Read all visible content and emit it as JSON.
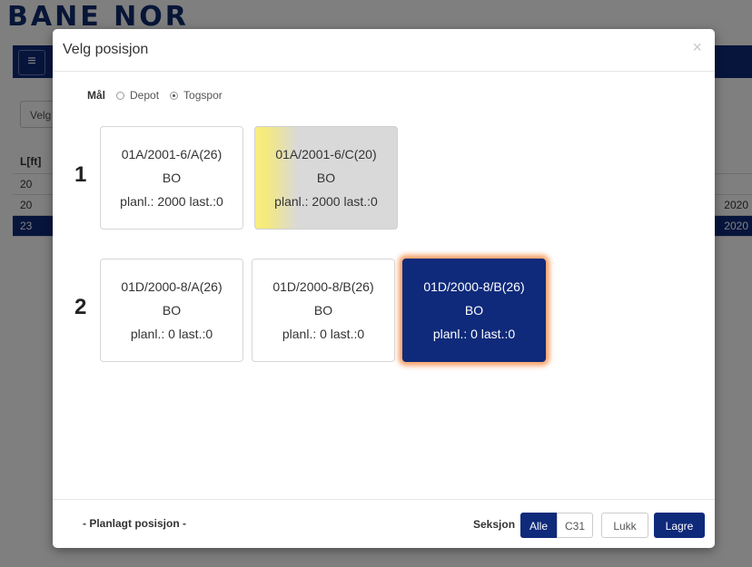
{
  "background": {
    "logo": "BANE NOR",
    "menu_icon": "hamburger-icon",
    "select_placeholder": "Velg",
    "table": {
      "header": "L[ft]",
      "rows": [
        {
          "value": "20",
          "right": ""
        },
        {
          "value": "20",
          "right": "2020"
        },
        {
          "value": "23",
          "right": "2020"
        }
      ]
    }
  },
  "modal": {
    "title": "Velg posisjon",
    "close_icon": "close-icon",
    "mal": {
      "label": "Mål",
      "options": [
        "Depot",
        "Togspor"
      ],
      "selected": "Togspor"
    },
    "groups": [
      {
        "number": "1",
        "cards": [
          {
            "code": "01A/2001-6/A(26)",
            "type": "BO",
            "status": "planl.: 2000 last.:0",
            "state": "normal"
          },
          {
            "code": "01A/2001-6/C(20)",
            "type": "BO",
            "status": "planl.: 2000 last.:0",
            "state": "occupied"
          }
        ]
      },
      {
        "number": "2",
        "cards": [
          {
            "code": "01D/2000-8/A(26)",
            "type": "BO",
            "status": "planl.: 0 last.:0",
            "state": "normal"
          },
          {
            "code": "01D/2000-8/B(26)",
            "type": "BO",
            "status": "planl.: 0 last.:0",
            "state": "normal"
          },
          {
            "code": "01D/2000-8/B(26)",
            "type": "BO",
            "status": "planl.: 0 last.:0",
            "state": "selected"
          }
        ]
      }
    ],
    "footer": {
      "planned_position": "- Planlagt posisjon -",
      "seksjon_label": "Seksjon",
      "buttons": {
        "alle": "Alle",
        "c31": "C31",
        "lukk": "Lukk",
        "lagre": "Lagre"
      }
    }
  },
  "colors": {
    "brand": "#0f2a7a",
    "occupied_accent": "#f9ef7d",
    "selected_glow": "#f58c46"
  }
}
